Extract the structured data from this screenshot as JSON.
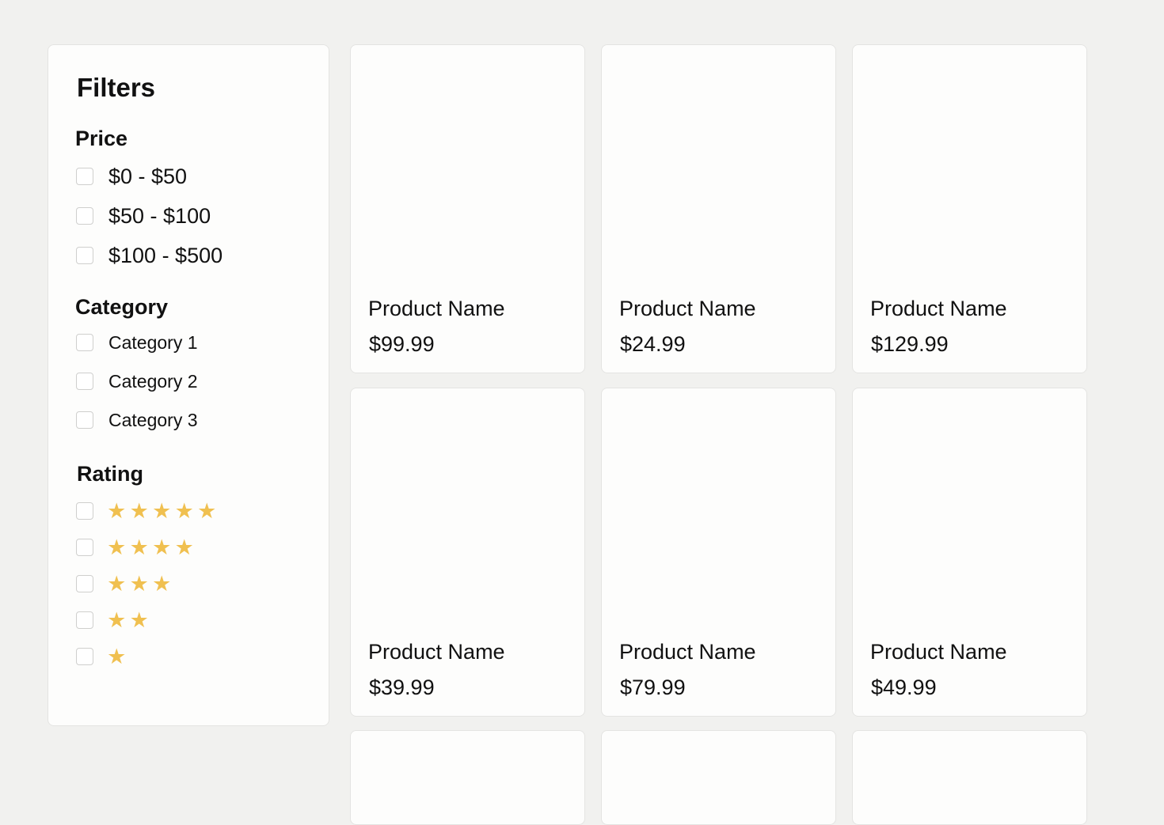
{
  "filters": {
    "title": "Filters",
    "price": {
      "heading": "Price",
      "options": [
        "$0 - $50",
        "$50 - $100",
        "$100 - $500"
      ]
    },
    "category": {
      "heading": "Category",
      "options": [
        "Category 1",
        "Category 2",
        "Category 3"
      ]
    },
    "rating": {
      "heading": "Rating",
      "options": [
        {
          "stars": 5
        },
        {
          "stars": 4
        },
        {
          "stars": 3
        },
        {
          "stars": 2
        },
        {
          "stars": 1
        }
      ],
      "star_icon": "star-icon",
      "star_color": "#f0c050"
    }
  },
  "products": [
    {
      "name": "Product Name",
      "price": "$99.99"
    },
    {
      "name": "Product Name",
      "price": "$24.99"
    },
    {
      "name": "Product Name",
      "price": "$129.99"
    },
    {
      "name": "Product Name",
      "price": "$39.99"
    },
    {
      "name": "Product Name",
      "price": "$79.99"
    },
    {
      "name": "Product Name",
      "price": "$49.99"
    }
  ],
  "colors": {
    "background": "#f1f1ef",
    "card": "#fdfdfc",
    "border": "#e4e4e2",
    "text": "#111111"
  }
}
